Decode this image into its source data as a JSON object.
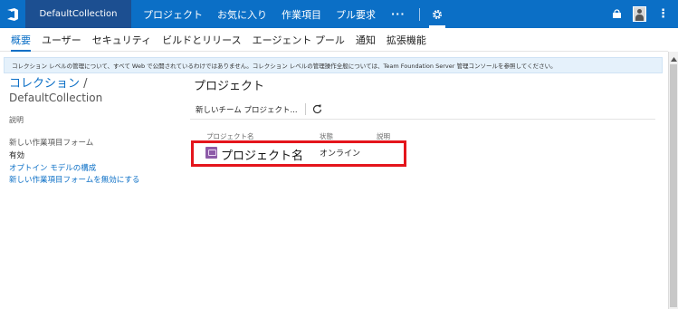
{
  "topbar": {
    "logo_icon": "vsts-logo-icon",
    "collection": "DefaultCollection",
    "nav": [
      "プロジェクト",
      "お気に入り",
      "作業項目",
      "プル要求"
    ],
    "more": "···",
    "settings_icon": "gear-icon",
    "bag_icon": "shopping-bag-icon",
    "avatar_icon": "user-avatar-icon",
    "more_vertical": "⋮",
    "color": "#0b6fc6",
    "collection_color": "#1c4f91"
  },
  "subnav": {
    "tabs": [
      "概要",
      "ユーザー",
      "セキュリティ",
      "ビルドとリリース",
      "エージェント プール",
      "通知",
      "拡張機能"
    ],
    "active_index": 0
  },
  "banner": {
    "text": "コレクション レベルの管理について、すべて Web で公開されているわけではありません。コレクション レベルの管理操作全般については、Team Foundation Server 管理コンソールを参照してください。"
  },
  "left": {
    "collection_link": "コレクション",
    "slash": " /",
    "collection_name": "DefaultCollection",
    "description_label": "説明",
    "form_heading": "新しい作業項目フォーム",
    "form_status": "有効",
    "link_optin": "オプトイン モデルの構成",
    "link_disable": "新しい作業項目フォームを無効にする"
  },
  "main": {
    "title": "プロジェクト",
    "new_project": "新しいチーム プロジェクト...",
    "refresh_icon": "refresh-icon",
    "columns": {
      "name": "プロジェクト名",
      "state": "状態",
      "description": "説明"
    },
    "projects": [
      {
        "name": "プロジェクト名",
        "state": "オンライン",
        "description": "",
        "icon": "project-icon"
      }
    ],
    "highlight_color": "#e4151c"
  }
}
